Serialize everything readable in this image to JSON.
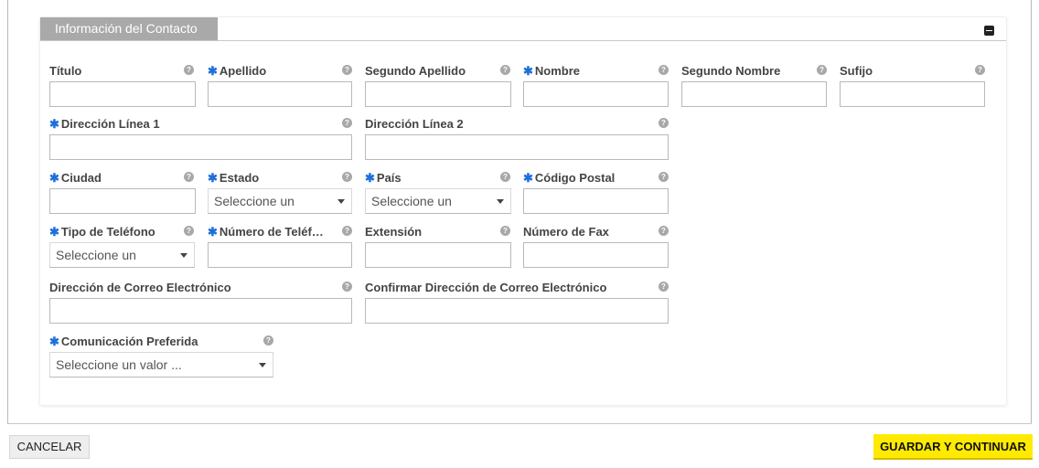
{
  "panel": {
    "title": "Información del Contacto",
    "help_glyph": "?",
    "required_glyph": "✱"
  },
  "fields": {
    "titulo": {
      "label": "Título",
      "value": ""
    },
    "apellido": {
      "label": "Apellido",
      "value": "",
      "required": true
    },
    "segundo_apellido": {
      "label": "Segundo Apellido",
      "value": ""
    },
    "nombre": {
      "label": "Nombre",
      "value": "",
      "required": true
    },
    "segundo_nombre": {
      "label": "Segundo Nombre",
      "value": ""
    },
    "sufijo": {
      "label": "Sufijo",
      "value": ""
    },
    "direccion1": {
      "label": "Dirección Línea 1",
      "value": "",
      "required": true
    },
    "direccion2": {
      "label": "Dirección Línea 2",
      "value": ""
    },
    "ciudad": {
      "label": "Ciudad",
      "value": "",
      "required": true
    },
    "estado": {
      "label": "Estado",
      "selected": "Seleccione un",
      "required": true
    },
    "pais": {
      "label": "País",
      "selected": "Seleccione un",
      "required": true
    },
    "codigo_postal": {
      "label": "Código Postal",
      "value": "",
      "required": true
    },
    "tipo_telefono": {
      "label": "Tipo de Teléfono",
      "selected": "Seleccione un",
      "required": true
    },
    "numero_telefono": {
      "label": "Número de Teléf…",
      "value": "",
      "required": true
    },
    "extension": {
      "label": "Extensión",
      "value": ""
    },
    "fax": {
      "label": "Número de Fax",
      "value": ""
    },
    "correo": {
      "label": "Dirección de Correo Electrónico",
      "value": ""
    },
    "confirmar_correo": {
      "label": "Confirmar Dirección de Correo Electrónico",
      "value": ""
    },
    "comunicacion": {
      "label": "Comunicación Preferida",
      "selected": "Seleccione un valor ...",
      "required": true
    }
  },
  "footer": {
    "cancel_label": "CANCELAR",
    "save_label": "GUARDAR Y CONTINUAR"
  },
  "colors": {
    "required": "#1e6fd9",
    "save_button": "#ffea00",
    "panel_tab": "#a9a9a9"
  }
}
